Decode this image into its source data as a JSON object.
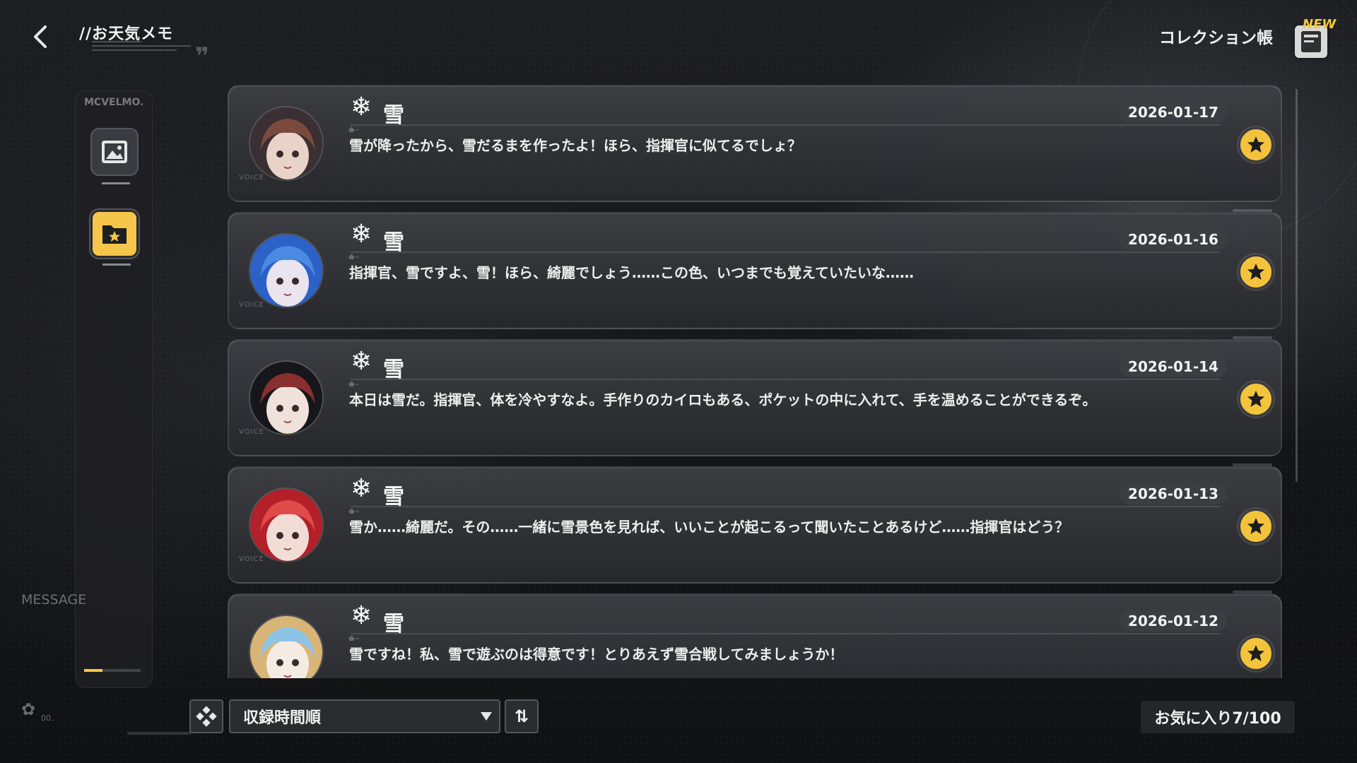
{
  "header": {
    "title": "//お天気メモ",
    "collection_label": "コレクション帳",
    "new_badge": "NEW"
  },
  "sidebar": {
    "logo": "MCVELMO.",
    "message_label": "MESSAGE",
    "items": [
      {
        "name": "gallery",
        "icon": "image-icon",
        "selected": false
      },
      {
        "name": "favorite-folder",
        "icon": "star-folder-icon",
        "selected": true
      }
    ]
  },
  "entries": [
    {
      "weather_icon": "❄",
      "weather": "雪",
      "date": "2026-01-17",
      "text": "雪が降ったから、雪だるまを作ったよ！ほら、指揮官に似てるでしょ？",
      "favorite": true,
      "avatar_colors": [
        "#3a2f33",
        "#7a4a3e",
        "#e9d3c8"
      ]
    },
    {
      "weather_icon": "❄",
      "weather": "雪",
      "date": "2026-01-16",
      "text": "指揮官、雪ですよ、雪！ほら、綺麗でしょう……この色、いつまでも覚えていたいな……",
      "favorite": true,
      "avatar_colors": [
        "#2c62c7",
        "#4a8ae0",
        "#e9e4ee"
      ]
    },
    {
      "weather_icon": "❄",
      "weather": "雪",
      "date": "2026-01-14",
      "text": "本日は雪だ。指揮官、体を冷やすなよ。手作りのカイロもある、ポケットの中に入れて、手を温めることができるぞ。",
      "favorite": true,
      "avatar_colors": [
        "#17171b",
        "#8a2f2f",
        "#efe2da"
      ]
    },
    {
      "weather_icon": "❄",
      "weather": "雪",
      "date": "2026-01-13",
      "text": "雪か……綺麗だ。その……一緒に雪景色を見れば、いいことが起こるって聞いたことあるけど……指揮官はどう？",
      "favorite": true,
      "avatar_colors": [
        "#b3202a",
        "#e04a4a",
        "#f1ddd6"
      ]
    },
    {
      "weather_icon": "❄",
      "weather": "雪",
      "date": "2026-01-12",
      "text": "雪ですね！私、雪で遊ぶのは得意です！とりあえず雪合戦してみましょうか！",
      "favorite": true,
      "avatar_colors": [
        "#d9b677",
        "#8ec3e8",
        "#f4ece2"
      ]
    }
  ],
  "avatar_tag": "VOICE",
  "footer": {
    "sort_label": "収録時間順",
    "order_icon": "⇅",
    "favorites_count": "お気に入り7/100"
  },
  "colors": {
    "accent_gold": "#f4c33c",
    "card_bg": "#333438",
    "page_bg": "#141518"
  }
}
